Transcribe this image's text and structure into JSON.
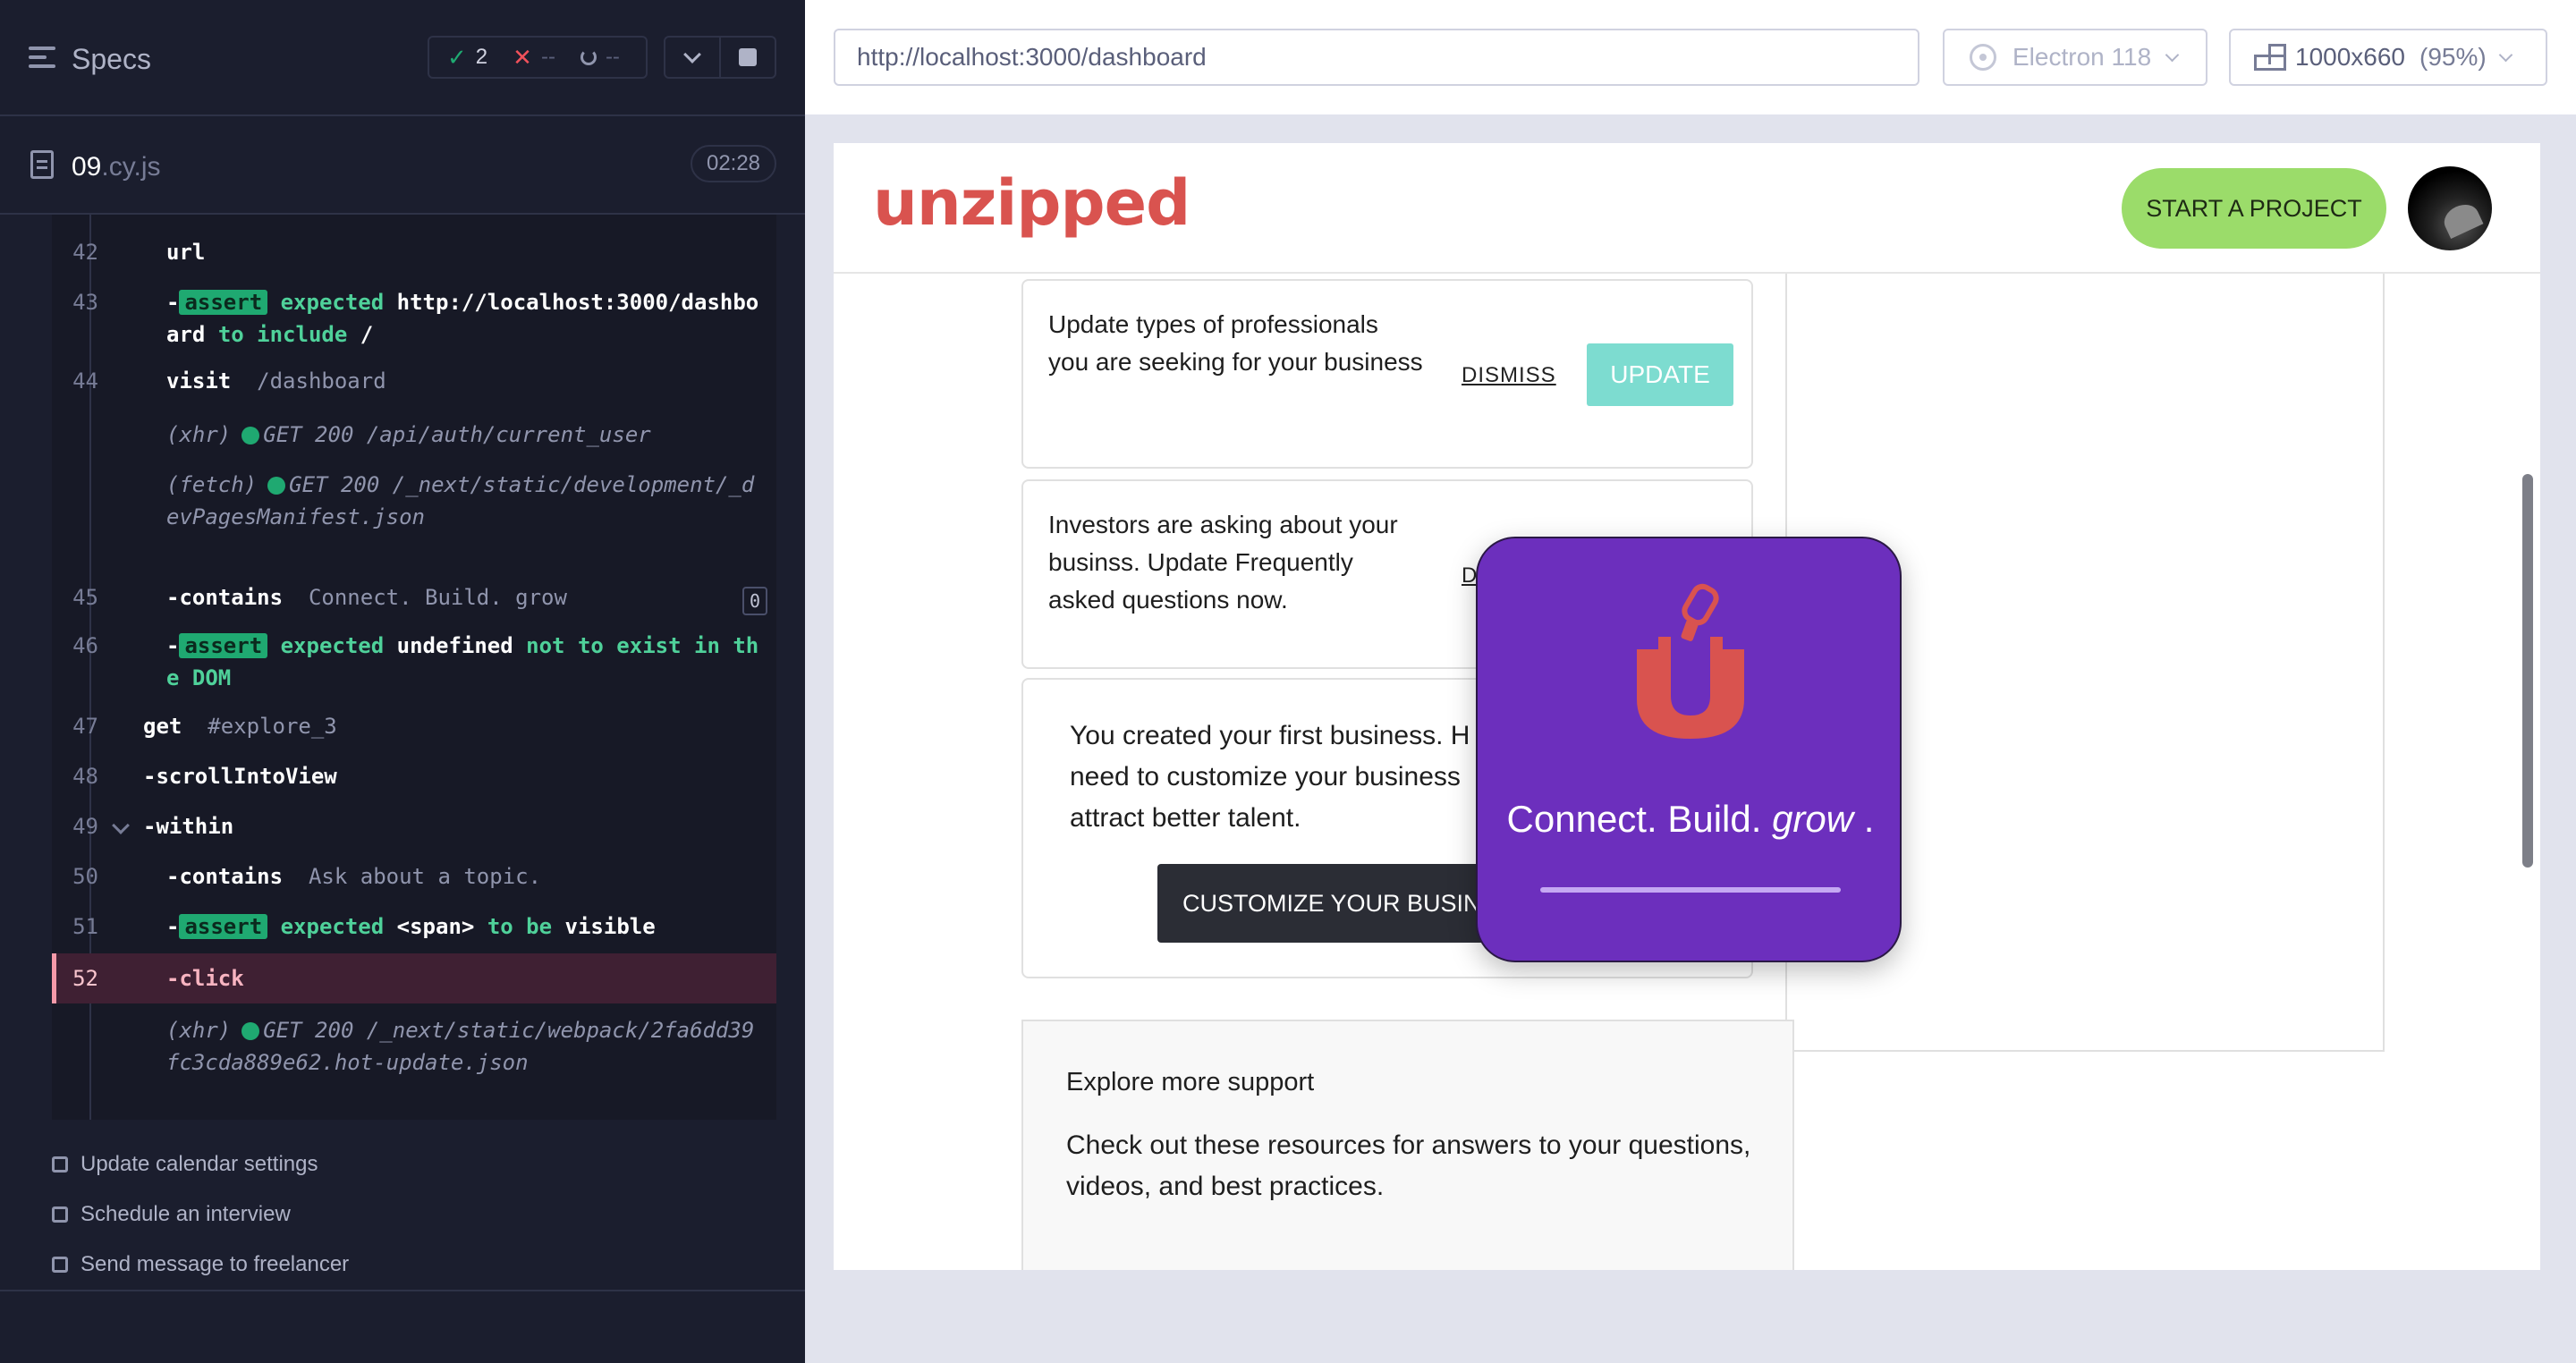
{
  "reporter": {
    "title": "Specs",
    "stats": {
      "passed": "2",
      "failed": "--",
      "pending": "--"
    },
    "file": {
      "name": "09",
      "ext": ".cy.js"
    },
    "duration": "02:28",
    "commands": [
      {
        "line": "42",
        "name": "url",
        "args": ""
      },
      {
        "line": "43",
        "name": "assert",
        "text_a": "expected",
        "text_b": "http://localhost:3000/dashboard",
        "text_c": "to include",
        "text_d": "/"
      },
      {
        "line": "44",
        "name": "visit",
        "args": "/dashboard"
      },
      {
        "line": "",
        "type": "(xhr)",
        "request": "GET 200 /api/auth/current_user"
      },
      {
        "line": "",
        "type": "(fetch)",
        "request": "GET 200 /_next/static/development/_devPagesManifest.json"
      },
      {
        "line": "45",
        "name": "contains",
        "args": "Connect. Build. grow",
        "count": "0"
      },
      {
        "line": "46",
        "name": "assert",
        "text_a": "expected",
        "text_b": "undefined",
        "text_c": "not to exist in the DOM"
      },
      {
        "line": "47",
        "name": "get",
        "args": "#explore_3"
      },
      {
        "line": "48",
        "name": "scrollIntoView"
      },
      {
        "line": "49",
        "name": "within"
      },
      {
        "line": "50",
        "name": "contains",
        "args": "Ask about a topic."
      },
      {
        "line": "51",
        "name": "assert",
        "text_a": "expected",
        "text_b": "<span>",
        "text_c": "to be",
        "text_d": "visible"
      },
      {
        "line": "52",
        "name": "click"
      },
      {
        "line": "",
        "type": "(xhr)",
        "request": "GET 200 /_next/static/webpack/2fa6dd39fc3cda889e62.hot-update.json"
      }
    ],
    "pending_tests": [
      "Update calendar settings",
      "Schedule an interview",
      "Send message to freelancer"
    ]
  },
  "runner": {
    "url": "http://localhost:3000/dashboard",
    "browser": "Electron 118",
    "viewport": "1000x660",
    "viewport_scale": "(95%)"
  },
  "app": {
    "logo": "unzipped",
    "start_button": "START A PROJECT",
    "cards": [
      {
        "text": "Update types of professionals you are seeking for your business",
        "dismiss": "DISMISS",
        "action": "UPDATE"
      },
      {
        "text": "Investors are asking about your businss. Update Frequently asked questions now.",
        "dismiss": "D"
      },
      {
        "text": "You created your first business. H need to customize your business attract better talent.",
        "action": "CUSTOMIZE YOUR BUSIN"
      }
    ],
    "explore": {
      "title": "Explore more support",
      "text": "Check out these resources for answers to your questions, videos, and best practices."
    },
    "splash": {
      "text_plain": "Connect. Build.",
      "text_em": "grow",
      "text_end": " ."
    }
  },
  "colors": {
    "brand_red": "#d9534f",
    "splash_purple": "#6c2fbd",
    "start_green": "#9bdc6a",
    "update_teal": "#7ddcd0",
    "pass_green": "#1fa971",
    "fail_red": "#f1515b"
  },
  "icons": [
    "specs-list-icon",
    "pass-check-icon",
    "fail-x-icon",
    "pending-spinner-icon",
    "chevron-down-icon",
    "stop-icon",
    "file-icon",
    "electron-icon",
    "ruler-icon",
    "zip-u-logo-icon"
  ]
}
